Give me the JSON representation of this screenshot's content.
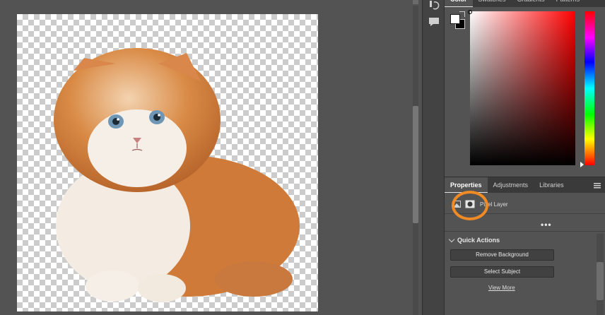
{
  "canvas": {
    "document_image": "kitten-cutout-on-transparent",
    "accent_highlight": "#f08a24"
  },
  "icon_strip": {
    "icons": [
      "history-icon",
      "comment-icon"
    ]
  },
  "color_panel": {
    "tabs": [
      "Color",
      "Swatches",
      "Gradients",
      "Patterns"
    ],
    "active_tab": "Color",
    "foreground_color": "#ffffff",
    "background_color": "#000000",
    "hue_color": "#ff0000"
  },
  "properties_panel": {
    "tabs": [
      "Properties",
      "Adjustments",
      "Libraries"
    ],
    "active_tab": "Properties",
    "layer_type": "Pixel Layer",
    "more_options": "•••",
    "quick_actions": {
      "title": "Quick Actions",
      "buttons": [
        "Remove Background",
        "Select Subject"
      ],
      "view_more": "View More"
    }
  }
}
